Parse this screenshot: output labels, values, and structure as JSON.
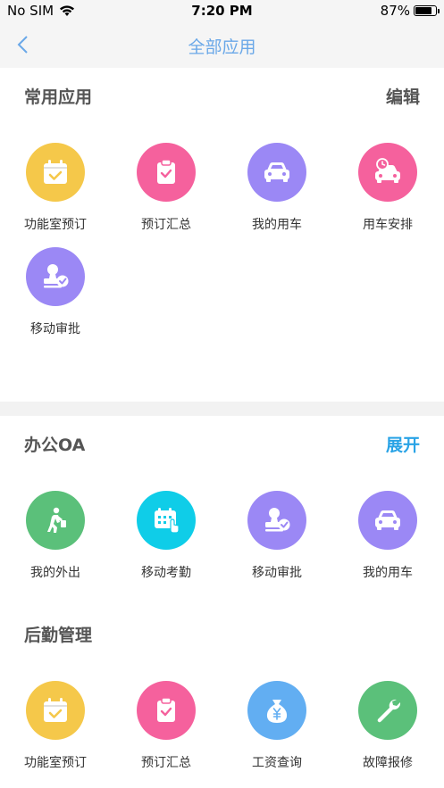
{
  "status": {
    "carrier": "No SIM",
    "time": "7:20 PM",
    "battery": "87%",
    "battery_level": 0.87
  },
  "nav": {
    "title": "全部应用",
    "back_icon": "chevron-left-icon"
  },
  "colors": {
    "yellow": "#f5c84a",
    "pink": "#f5619d",
    "purple": "#9b88f5",
    "cyan": "#0fcde8",
    "green": "#5bc07a",
    "blue": "#62aef2",
    "title_blue": "#6aa8e8",
    "action_blue": "#29a3e6"
  },
  "sections": {
    "common": {
      "title": "常用应用",
      "action": "编辑",
      "apps": [
        {
          "label": "功能室预订",
          "icon": "calendar-check-icon",
          "color": "yellow"
        },
        {
          "label": "预订汇总",
          "icon": "clipboard-check-icon",
          "color": "pink"
        },
        {
          "label": "我的用车",
          "icon": "car-icon",
          "color": "purple"
        },
        {
          "label": "用车安排",
          "icon": "car-clock-icon",
          "color": "pink"
        },
        {
          "label": "移动审批",
          "icon": "stamp-icon",
          "color": "purple"
        }
      ]
    },
    "oa": {
      "title": "办公OA",
      "action": "展开",
      "apps": [
        {
          "label": "我的外出",
          "icon": "walking-person-icon",
          "color": "green"
        },
        {
          "label": "移动考勤",
          "icon": "calendar-touch-icon",
          "color": "cyan"
        },
        {
          "label": "移动审批",
          "icon": "stamp-icon",
          "color": "purple"
        },
        {
          "label": "我的用车",
          "icon": "car-icon",
          "color": "purple"
        }
      ]
    },
    "logistics": {
      "title": "后勤管理",
      "apps": [
        {
          "label": "功能室预订",
          "icon": "calendar-check-icon",
          "color": "yellow"
        },
        {
          "label": "预订汇总",
          "icon": "clipboard-check-icon",
          "color": "pink"
        },
        {
          "label": "工资查询",
          "icon": "money-bag-icon",
          "color": "blue"
        },
        {
          "label": "故障报修",
          "icon": "wrench-icon",
          "color": "green"
        }
      ]
    }
  }
}
